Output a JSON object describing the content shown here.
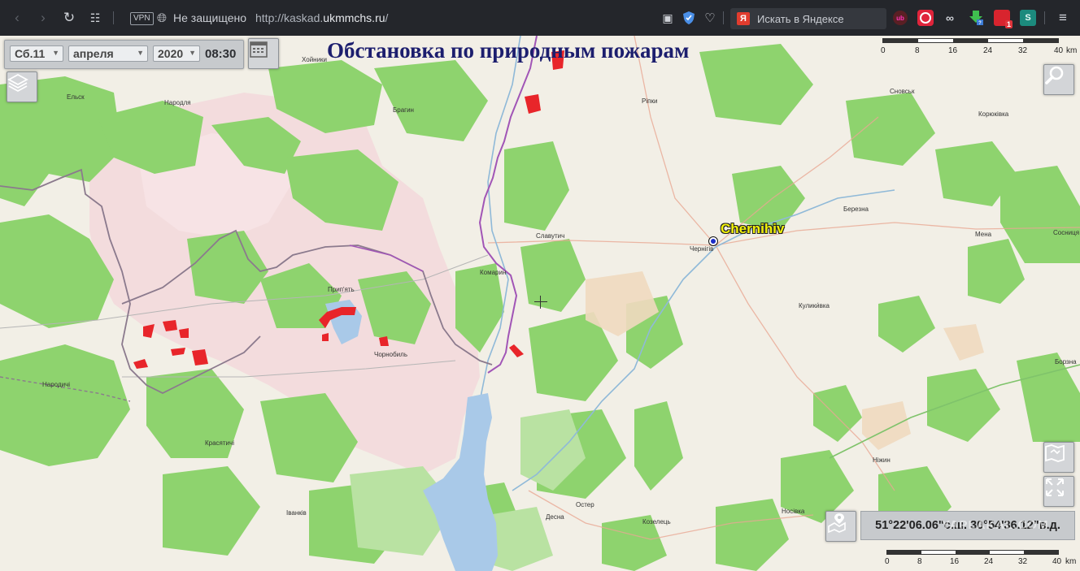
{
  "browser": {
    "vpn_label": "VPN",
    "security_label": "Не защищено",
    "url_prefix": "http://kaskad.",
    "url_domain": "ukmmchs.ru",
    "url_suffix": "/",
    "search_placeholder": "Искать в Яндексе",
    "yandex_letter": "Я",
    "ext_ud": "ub",
    "ext_badge": "1",
    "ext_s": "S"
  },
  "map": {
    "title": "Обстановка по природным пожарам",
    "date": {
      "day": "Сб.11",
      "month": "апреля",
      "year": "2020",
      "time": "08:30"
    },
    "highlight_city": "Chernihiv",
    "coordinates": "51°22'06.06\"с.ш. 30°54'36.12\"в.д.",
    "watermark": "YAPLAKAL.COM",
    "scale": {
      "ticks": [
        "0",
        "8",
        "16",
        "24",
        "32",
        "40"
      ],
      "unit": "km"
    },
    "cities": {
      "khoiniki": "Хойники",
      "elsk": "Ельск",
      "narovlya": "Народля",
      "bragin": "Брагин",
      "ripki": "Рiпки",
      "snovsk": "Сновськ",
      "koryukivka": "Корюківка",
      "berezna": "Березна",
      "mena": "Мена",
      "sosnytsia": "Сосниця",
      "slavutych": "Славутич",
      "chernihiv": "Чернігів",
      "komaryn": "Комарин",
      "prypiat": "Прип'ять",
      "chornobyl": "Чорнобиль",
      "kulykivka": "Кулики́вка",
      "narodychi": "Народичі",
      "borzna": "Борзна",
      "krasiatychi": "Красятичі",
      "nizhyn": "Ніжин",
      "ivankiv": "Іванків",
      "oster": "Остер",
      "desna": "Десна",
      "kozelets": "Козелець",
      "nosivka": "Носівка"
    }
  }
}
